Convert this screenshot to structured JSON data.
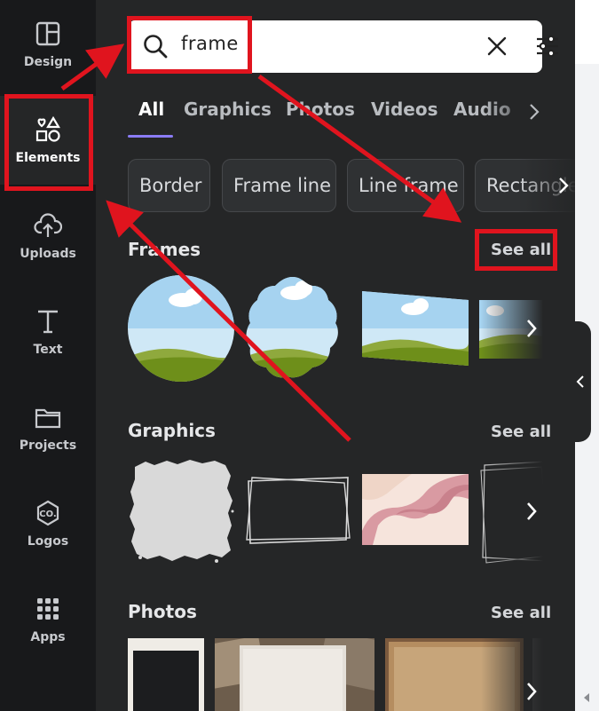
{
  "sidebar": {
    "items": [
      {
        "label": "Design",
        "icon": "layout-icon"
      },
      {
        "label": "Elements",
        "icon": "shapes-icon",
        "active": true
      },
      {
        "label": "Uploads",
        "icon": "cloud-upload-icon"
      },
      {
        "label": "Text",
        "icon": "text-t-icon"
      },
      {
        "label": "Projects",
        "icon": "folder-icon"
      },
      {
        "label": "Logos",
        "icon": "co-logo-icon"
      },
      {
        "label": "Apps",
        "icon": "grid-dots-icon"
      }
    ]
  },
  "search": {
    "value": "frame",
    "icons": [
      "search-icon",
      "clear-icon",
      "filter-sliders-icon"
    ]
  },
  "tabs": [
    "All",
    "Graphics",
    "Photos",
    "Videos",
    "Audio"
  ],
  "chips": [
    "Border",
    "Frame line",
    "Line frame",
    "Rectangle"
  ],
  "sections": {
    "frames": {
      "title": "Frames",
      "see_all": "See all"
    },
    "graphics": {
      "title": "Graphics",
      "see_all": "See all"
    },
    "photos": {
      "title": "Photos",
      "see_all": "See all"
    }
  },
  "colors": {
    "rail_bg": "#18191b",
    "panel_bg": "#252627",
    "accent": "#8b7cf6",
    "annotation": "#e0141e"
  }
}
